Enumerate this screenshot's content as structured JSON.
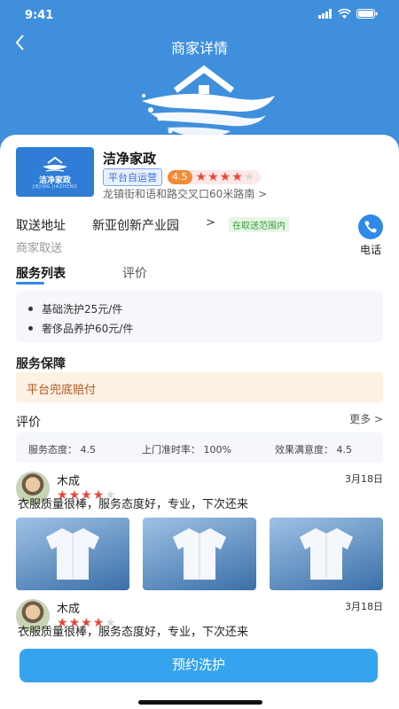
{
  "status_bar": {
    "time": "9:41"
  },
  "nav": {
    "title": "商家详情",
    "back_icon": "chevron-left-icon"
  },
  "shop": {
    "name": "洁净家政",
    "logo_text": "洁净家政",
    "logo_subtext": "JIEJING JIAZHENG",
    "badge": "平台自运营",
    "rating": "4.5",
    "stars_filled": 4,
    "stars_total": 5,
    "address": "龙镇街和语和路交叉口60米路南 >"
  },
  "pickup": {
    "label": "取送地址",
    "place": "新亚创新产业园",
    "arrow": ">",
    "range_tag": "在取送范围内",
    "mode": "商家取送",
    "phone_label": "电话"
  },
  "tabs": [
    {
      "label": "服务列表",
      "active": true
    },
    {
      "label": "评价",
      "active": false
    }
  ],
  "services": [
    {
      "label": "基础洗护25元/件"
    },
    {
      "label": "奢侈品养护60元/件"
    }
  ],
  "guarantee": {
    "title": "服务保障",
    "text": "平台兜底赔付"
  },
  "reviews_section": {
    "title": "评价",
    "more": "更多  >",
    "metrics": [
      {
        "text": "服务态度：  4.5"
      },
      {
        "text": "上门准时率：  100%"
      },
      {
        "text": "效果满意度：  4.5"
      }
    ]
  },
  "reviews": [
    {
      "name": "木成",
      "date": "3月18日",
      "stars_filled": 4,
      "text": "衣服质量很棒，服务态度好，专业，下次还来",
      "photos": 3
    },
    {
      "name": "木成",
      "date": "3月18日",
      "stars_filled": 4,
      "text": "衣服质量很棒，服务态度好，专业，下次还来",
      "photos": 0
    }
  ],
  "book_button": {
    "label": "预约洗护"
  },
  "colors": {
    "brand_blue": "#3f8fdc",
    "button_blue": "#35a3ee",
    "star_red": "#e9463b",
    "guarantee_text": "#b3561f"
  }
}
